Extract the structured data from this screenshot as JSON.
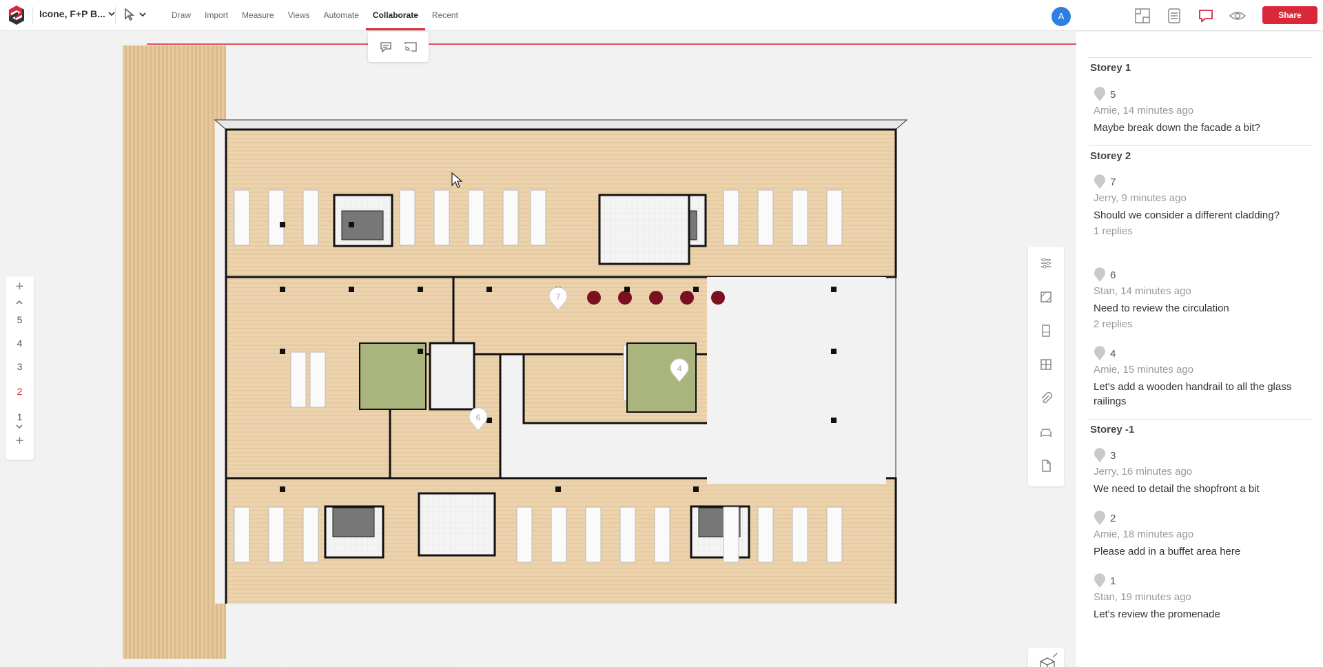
{
  "app": {
    "project_name": "Icone, F+P B...",
    "avatar_initial": "A",
    "share_label": "Share",
    "accent": "#d9283a"
  },
  "nav": [
    {
      "label": "Draw"
    },
    {
      "label": "Import"
    },
    {
      "label": "Measure"
    },
    {
      "label": "Views"
    },
    {
      "label": "Automate"
    },
    {
      "label": "Collaborate",
      "active": true
    },
    {
      "label": "Recent"
    }
  ],
  "floors": {
    "items": [
      "5",
      "4",
      "3",
      "2",
      "1"
    ],
    "active": "2"
  },
  "plan_pins": [
    "7",
    "4",
    "6"
  ],
  "comments": {
    "sections": [
      {
        "title": "Storey 1",
        "items": [
          {
            "id": "5",
            "meta": "Amie, 14 minutes ago",
            "text": "Maybe break down the facade a bit?",
            "replies": ""
          }
        ]
      },
      {
        "title": "Storey 2",
        "items": [
          {
            "id": "7",
            "meta": "Jerry, 9 minutes ago",
            "text": "Should we consider a different cladding?",
            "replies": "1 replies"
          },
          {
            "id": "6",
            "meta": "Stan, 14 minutes ago",
            "text": "Need to review the circulation",
            "replies": "2 replies"
          },
          {
            "id": "4",
            "meta": "Amie, 15 minutes ago",
            "text": "Let's add a wooden handrail to all the glass railings",
            "replies": ""
          }
        ]
      },
      {
        "title": "Storey -1",
        "items": [
          {
            "id": "3",
            "meta": "Jerry, 16 minutes ago",
            "text": "We need to detail the shopfront a bit",
            "replies": ""
          },
          {
            "id": "2",
            "meta": "Amie, 18 minutes ago",
            "text": "Please add in a buffet area here",
            "replies": ""
          },
          {
            "id": "1",
            "meta": "Stan, 19 minutes ago",
            "text": "Let's review the promenade",
            "replies": ""
          }
        ]
      }
    ]
  }
}
